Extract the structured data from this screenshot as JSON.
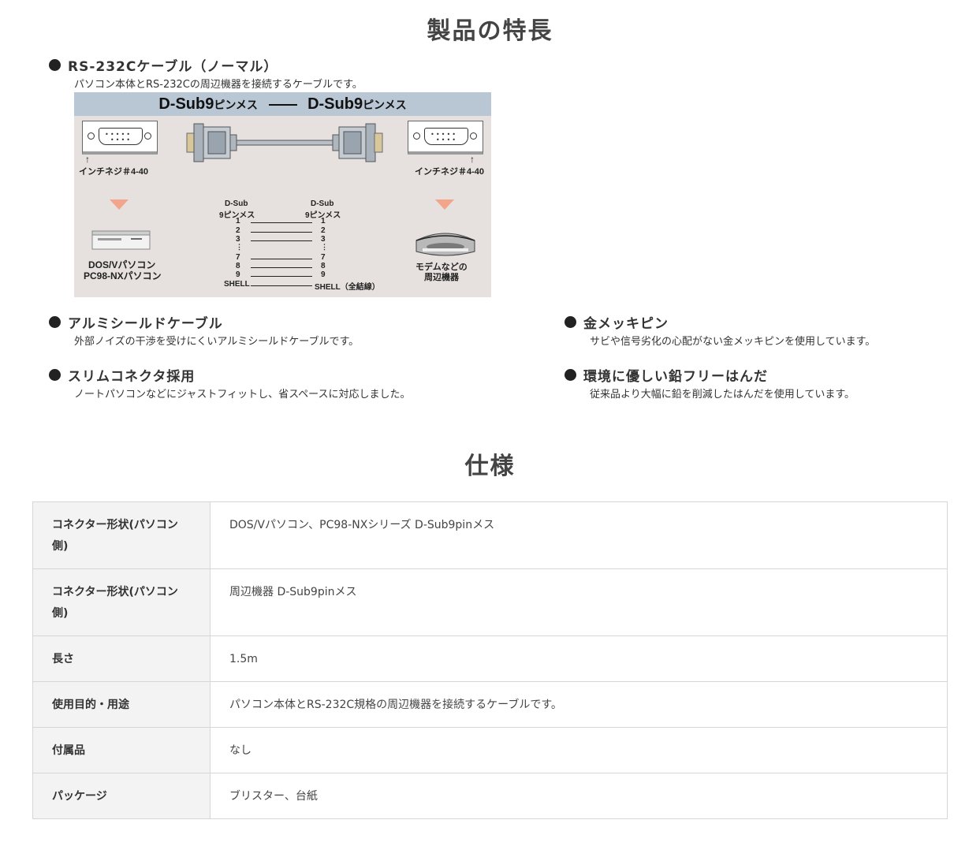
{
  "features_section": {
    "title": "製品の特長",
    "items": [
      {
        "title": "RS-232Cケーブル（ノーマル）",
        "description": "パソコン本体とRS-232Cの周辺機器を接続するケーブルです。"
      },
      {
        "title": "アルミシールドケーブル",
        "description": "外部ノイズの干渉を受けにくいアルミシールドケーブルです。"
      },
      {
        "title": "金メッキピン",
        "description": "サビや信号劣化の心配がない金メッキピンを使用しています。"
      },
      {
        "title": "スリムコネクタ採用",
        "description": "ノートパソコンなどにジャストフィットし、省スペースに対応しました。"
      },
      {
        "title": "環境に優しい鉛フリーはんだ",
        "description": "従来品より大幅に鉛を削減したはんだを使用しています。"
      }
    ]
  },
  "diagram": {
    "header_left_main": "D-Sub9",
    "header_left_small": "ピンメス",
    "header_right_main": "D-Sub9",
    "header_right_small": "ピンメス",
    "screw_label_left": "インチネジ＃4-40",
    "screw_label_right": "インチネジ＃4-40",
    "wiring_left_title_1": "D-Sub",
    "wiring_left_title_2": "9ピンメス",
    "wiring_right_title_1": "D-Sub",
    "wiring_right_title_2": "9ピンメス",
    "pins_left": [
      "1",
      "2",
      "3",
      "⋮",
      "7",
      "8",
      "9",
      "SHELL"
    ],
    "pins_right": [
      "1",
      "2",
      "3",
      "⋮",
      "7",
      "8",
      "9",
      "SHELL（全結線）"
    ],
    "pc_label_1": "DOS/Vパソコン",
    "pc_label_2": "PC98-NXパソコン",
    "peripheral_label_1": "モデムなどの",
    "peripheral_label_2": "周辺機器",
    "colors": {
      "header_bg": "#b9c6d3",
      "body_bg": "#e6e1de",
      "arrow": "#f2a58a",
      "connector_gold": "#d8c79a"
    }
  },
  "spec_section": {
    "title": "仕様",
    "rows": [
      {
        "label": "コネクター形状(パソコン側)",
        "value": "DOS/Vパソコン、PC98-NXシリーズ D-Sub9pinメス"
      },
      {
        "label": "コネクター形状(パソコン側)",
        "value": "周辺機器 D-Sub9pinメス"
      },
      {
        "label": "長さ",
        "value": "1.5m"
      },
      {
        "label": "使用目的・用途",
        "value": "パソコン本体とRS-232C規格の周辺機器を接続するケーブルです。"
      },
      {
        "label": "付属品",
        "value": "なし"
      },
      {
        "label": "パッケージ",
        "value": "ブリスター、台紙"
      }
    ]
  }
}
